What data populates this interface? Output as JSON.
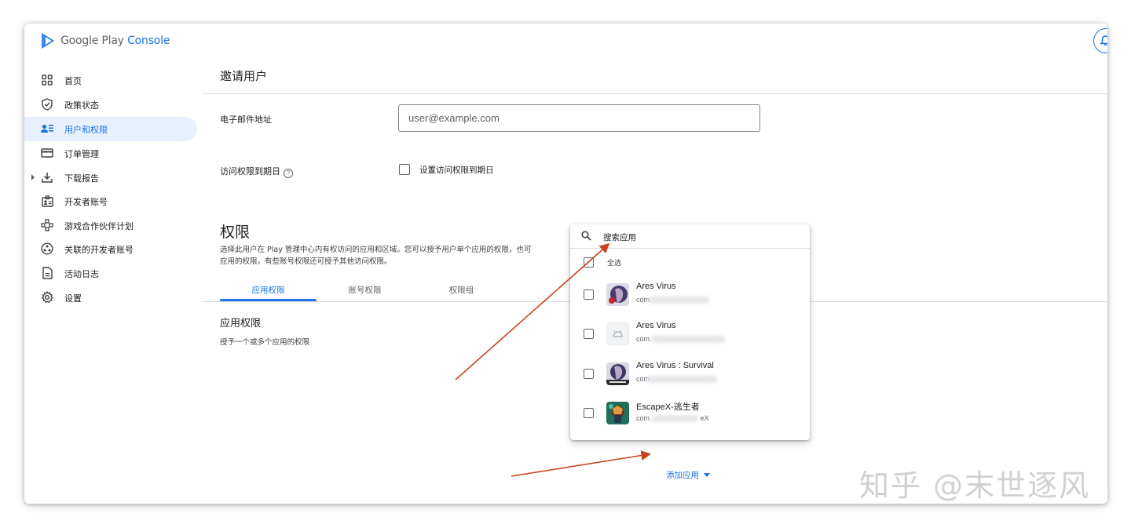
{
  "app": {
    "logo_text_main": "Google Play",
    "logo_text_accent": "Console"
  },
  "sidebar": {
    "items": [
      {
        "label": "首页",
        "icon": "dashboard-icon"
      },
      {
        "label": "政策状态",
        "icon": "shield-check-icon"
      },
      {
        "label": "用户和权限",
        "icon": "users-permissions-icon",
        "active": true
      },
      {
        "label": "订单管理",
        "icon": "credit-card-icon"
      },
      {
        "label": "下载报告",
        "icon": "download-icon",
        "expandable": true
      },
      {
        "label": "开发者账号",
        "icon": "developer-badge-icon"
      },
      {
        "label": "游戏合作伙伴计划",
        "icon": "partner-program-icon"
      },
      {
        "label": "关联的开发者账号",
        "icon": "linked-accounts-icon"
      },
      {
        "label": "活动日志",
        "icon": "document-icon"
      },
      {
        "label": "设置",
        "icon": "gear-icon"
      }
    ]
  },
  "page": {
    "title": "邀请用户",
    "email_label": "电子邮件地址",
    "email_placeholder": "user@example.com",
    "expiry_label": "访问权限到期日",
    "expiry_checkbox_label": "设置访问权限到期日",
    "permissions_title": "权限",
    "permissions_desc": "选择此用户在 Play 管理中心内有权访问的应用和区域。您可以授予用户单个应用的权限，也可",
    "permissions_desc_2": "应用的权限。有些账号权限还可授予其他访问权限。",
    "tabs": [
      "应用权限",
      "账号权限",
      "权限组"
    ],
    "active_tab": "应用权限",
    "app_permissions_title": "应用权限",
    "app_permissions_desc": "授予一个或多个应用的权限",
    "add_app_label": "添加应用"
  },
  "dropdown": {
    "search_placeholder": "搜索应用",
    "select_all_label": "全选",
    "apps": [
      {
        "name": "Ares Virus",
        "package": "com."
      },
      {
        "name": "Ares Virus",
        "package": "com."
      },
      {
        "name": "Ares Virus : Survival",
        "package": "com"
      },
      {
        "name": "EscapeX-逃生者",
        "package": "com.",
        "package_tail": "eX"
      }
    ]
  },
  "watermark": "知乎 @末世逐风",
  "colors": {
    "accent": "#1a73e8",
    "active_nav_bg": "#e8f0fe",
    "annotation_arrow": "#c9441e"
  }
}
